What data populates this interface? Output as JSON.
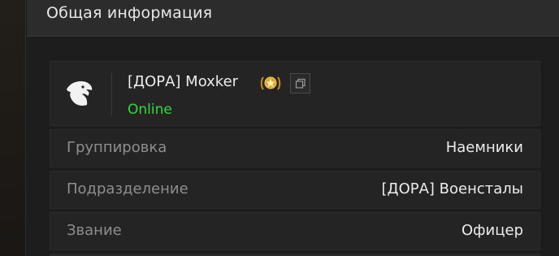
{
  "section": {
    "title": "Общая информация"
  },
  "player": {
    "name": "[ДОРА] Moxker",
    "status": "Online",
    "status_color": "#33d93d",
    "avatar_icon": "eagle-icon",
    "badge_icon": "gold-medal-icon",
    "copy_icon": "copy-icon"
  },
  "rows": [
    {
      "label": "Группировка",
      "value": "Наемники"
    },
    {
      "label": "Подразделение",
      "value": "[ДОРА] Военсталы"
    },
    {
      "label": "Звание",
      "value": "Офицер"
    }
  ],
  "colors": {
    "background": "#1b1b1b",
    "header": "#2c2c2c",
    "row_background": "#242424",
    "label": "#8e8e8e",
    "value": "#ececec",
    "badge_gold": "#e0a52a"
  }
}
